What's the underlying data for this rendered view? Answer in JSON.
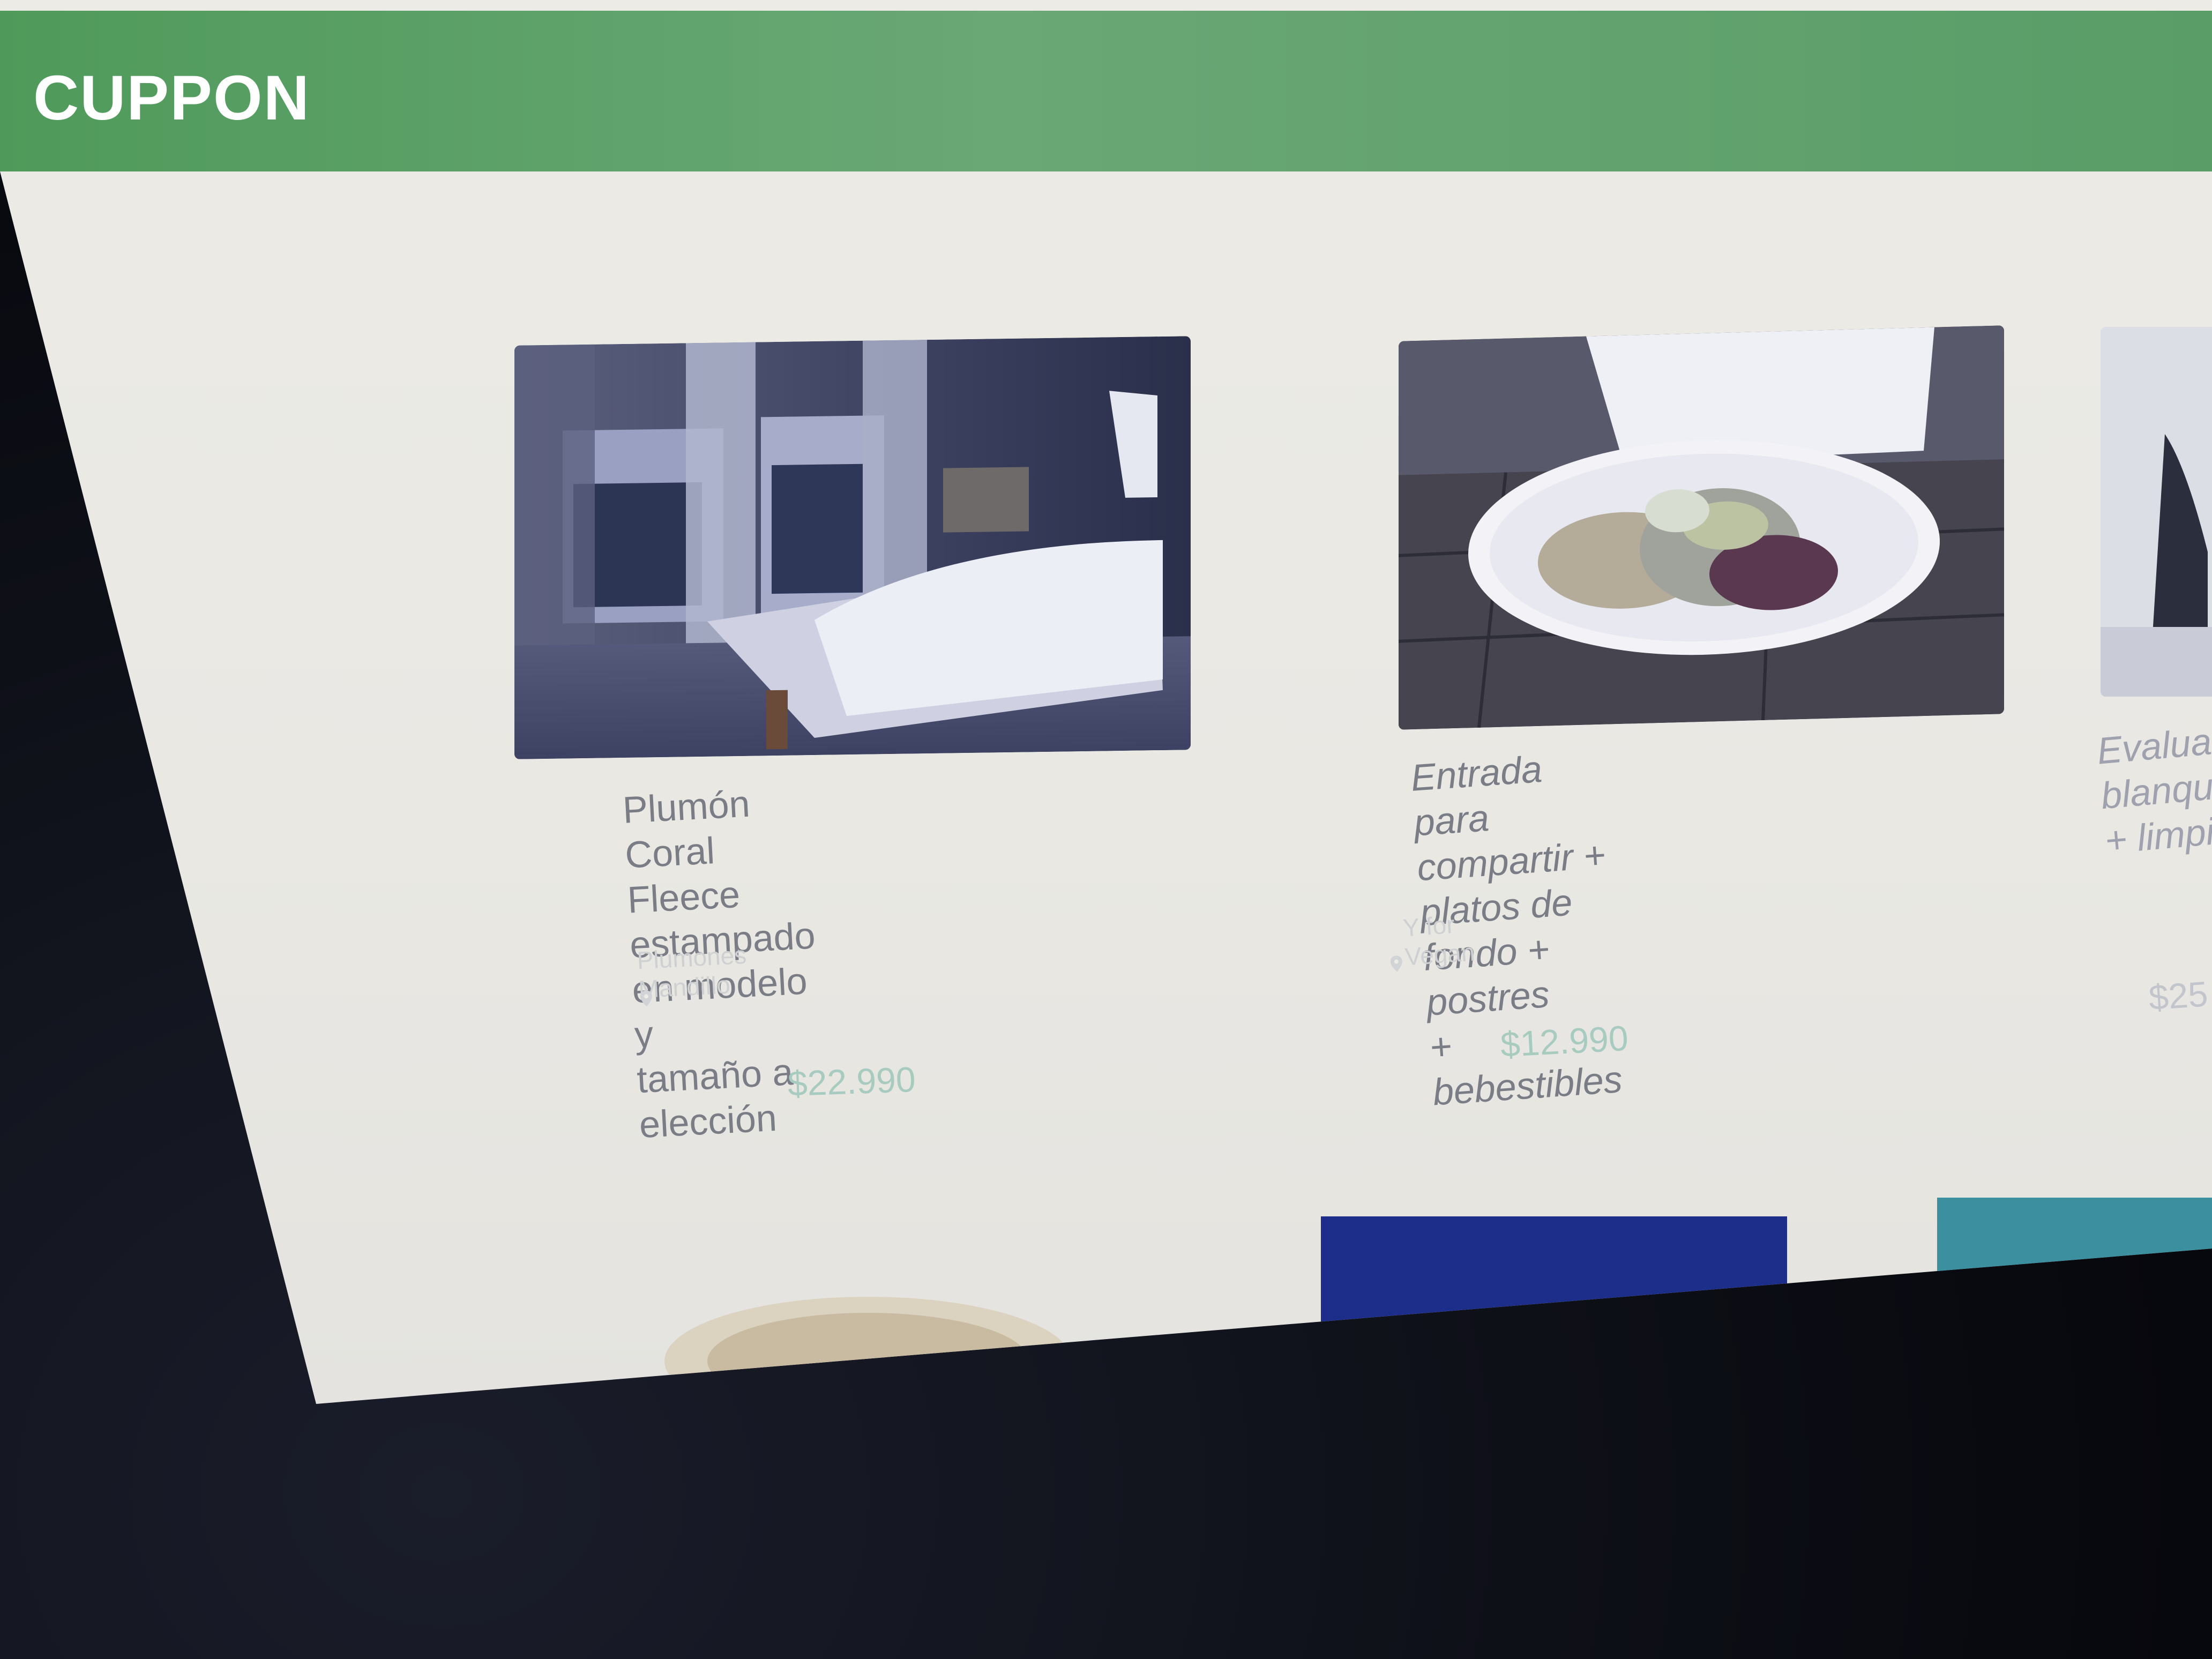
{
  "header": {
    "brand": "CUPPON",
    "color": "#5a9d67"
  },
  "cards": [
    {
      "title_lines": [
        "Plumón Coral Fleece",
        "estampado en modelo y",
        "tamaño a elección"
      ],
      "merchant": "Plumones Mandillo",
      "location": "",
      "price": "$22.990",
      "image": "bedroom-bed-photo"
    },
    {
      "title_lines": [
        "Entrada para compartir +",
        "platos de fondo + postres",
        "+ bebestibles"
      ],
      "merchant": "Y for Vegan",
      "location": "",
      "old_price": "",
      "price": "$12.990",
      "image": "salad-plate-photo"
    },
    {
      "title_lines": [
        "Evalua",
        "blanque",
        "+ limpie"
      ],
      "merchant": "",
      "location": "",
      "old_price": "",
      "price": "$25",
      "image": "dental-photo"
    }
  ],
  "colors": {
    "accent_price": "#a8cbc0",
    "title_text": "#7a7c86",
    "page_bg": "#ecebe6"
  }
}
